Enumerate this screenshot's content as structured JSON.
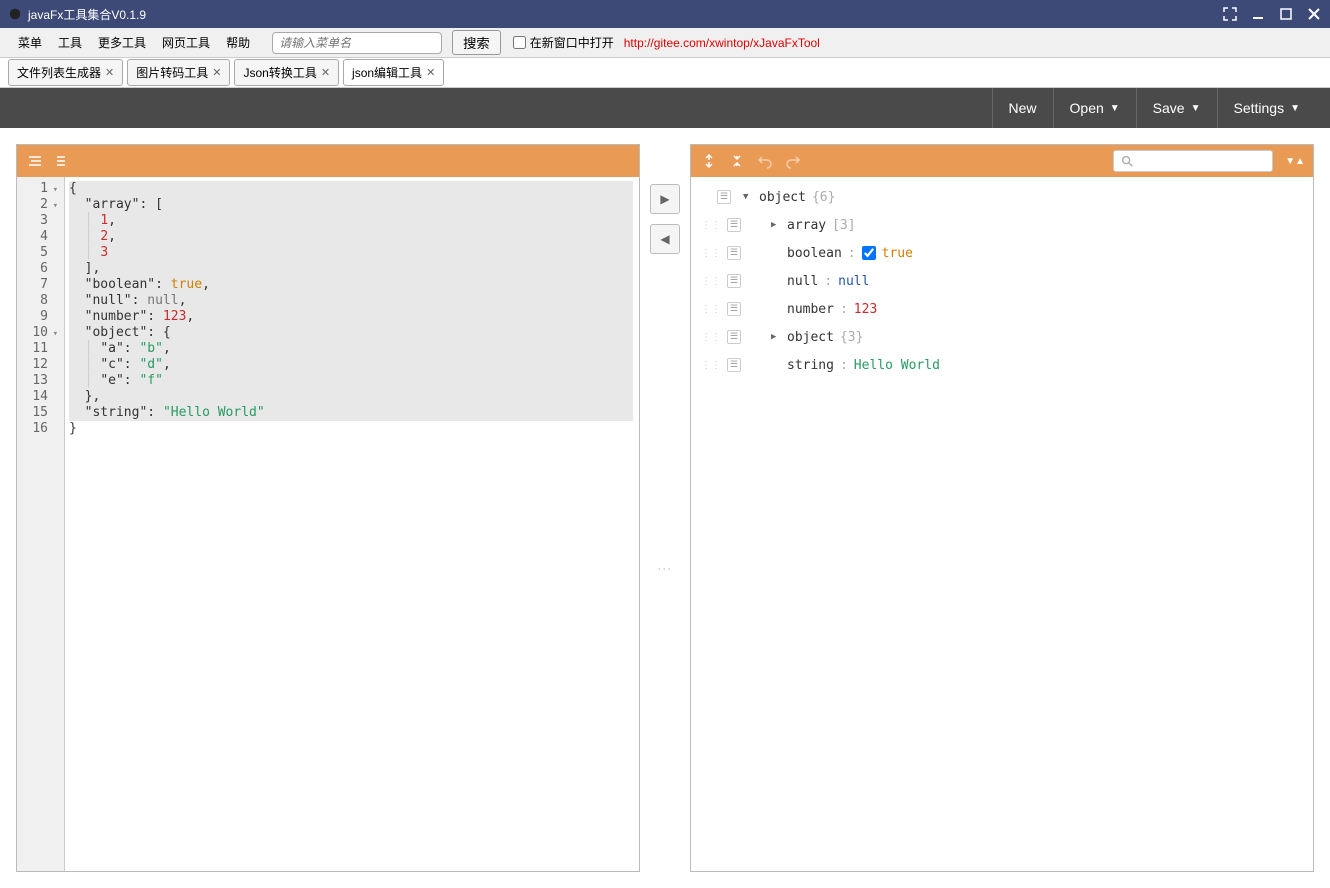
{
  "window": {
    "title": "javaFx工具集合V0.1.9"
  },
  "menu": {
    "items": [
      "菜单",
      "工具",
      "更多工具",
      "网页工具",
      "帮助"
    ],
    "search_placeholder": "请输入菜单名",
    "search_btn": "搜索",
    "checkbox_label": "在新窗口中打开",
    "link_url": "http://gitee.com/xwintop/xJavaFxTool"
  },
  "tabs": {
    "items": [
      "文件列表生成器",
      "图片转码工具",
      "Json转换工具",
      "json编辑工具"
    ],
    "active_index": 3
  },
  "darkbar": {
    "new": "New",
    "open": "Open",
    "save": "Save",
    "settings": "Settings"
  },
  "editor": {
    "lines": [
      {
        "n": 1,
        "fold": true,
        "hl": true,
        "tokens": [
          {
            "t": "{",
            "c": "punc"
          }
        ]
      },
      {
        "n": 2,
        "fold": true,
        "hl": true,
        "tokens": [
          {
            "t": "  ",
            "c": ""
          },
          {
            "t": "\"array\"",
            "c": "key"
          },
          {
            "t": ": [",
            "c": "punc"
          }
        ]
      },
      {
        "n": 3,
        "hl": true,
        "tokens": [
          {
            "t": "  ",
            "c": ""
          },
          {
            "t": "│ ",
            "c": "guide"
          },
          {
            "t": "1",
            "c": "num"
          },
          {
            "t": ",",
            "c": "punc"
          }
        ]
      },
      {
        "n": 4,
        "hl": true,
        "tokens": [
          {
            "t": "  ",
            "c": ""
          },
          {
            "t": "│ ",
            "c": "guide"
          },
          {
            "t": "2",
            "c": "num"
          },
          {
            "t": ",",
            "c": "punc"
          }
        ]
      },
      {
        "n": 5,
        "hl": true,
        "tokens": [
          {
            "t": "  ",
            "c": ""
          },
          {
            "t": "│ ",
            "c": "guide"
          },
          {
            "t": "3",
            "c": "num"
          }
        ]
      },
      {
        "n": 6,
        "hl": true,
        "tokens": [
          {
            "t": "  ],",
            "c": "punc"
          }
        ]
      },
      {
        "n": 7,
        "hl": true,
        "tokens": [
          {
            "t": "  ",
            "c": ""
          },
          {
            "t": "\"boolean\"",
            "c": "key"
          },
          {
            "t": ": ",
            "c": "punc"
          },
          {
            "t": "true",
            "c": "bool"
          },
          {
            "t": ",",
            "c": "punc"
          }
        ]
      },
      {
        "n": 8,
        "hl": true,
        "tokens": [
          {
            "t": "  ",
            "c": ""
          },
          {
            "t": "\"null\"",
            "c": "key"
          },
          {
            "t": ": ",
            "c": "punc"
          },
          {
            "t": "null",
            "c": "null"
          },
          {
            "t": ",",
            "c": "punc"
          }
        ]
      },
      {
        "n": 9,
        "hl": true,
        "tokens": [
          {
            "t": "  ",
            "c": ""
          },
          {
            "t": "\"number\"",
            "c": "key"
          },
          {
            "t": ": ",
            "c": "punc"
          },
          {
            "t": "123",
            "c": "num"
          },
          {
            "t": ",",
            "c": "punc"
          }
        ]
      },
      {
        "n": 10,
        "fold": true,
        "hl": true,
        "tokens": [
          {
            "t": "  ",
            "c": ""
          },
          {
            "t": "\"object\"",
            "c": "key"
          },
          {
            "t": ": {",
            "c": "punc"
          }
        ]
      },
      {
        "n": 11,
        "hl": true,
        "tokens": [
          {
            "t": "  ",
            "c": ""
          },
          {
            "t": "│ ",
            "c": "guide"
          },
          {
            "t": "\"a\"",
            "c": "key"
          },
          {
            "t": ": ",
            "c": "punc"
          },
          {
            "t": "\"b\"",
            "c": "str"
          },
          {
            "t": ",",
            "c": "punc"
          }
        ]
      },
      {
        "n": 12,
        "hl": true,
        "tokens": [
          {
            "t": "  ",
            "c": ""
          },
          {
            "t": "│ ",
            "c": "guide"
          },
          {
            "t": "\"c\"",
            "c": "key"
          },
          {
            "t": ": ",
            "c": "punc"
          },
          {
            "t": "\"d\"",
            "c": "str"
          },
          {
            "t": ",",
            "c": "punc"
          }
        ]
      },
      {
        "n": 13,
        "hl": true,
        "tokens": [
          {
            "t": "  ",
            "c": ""
          },
          {
            "t": "│ ",
            "c": "guide"
          },
          {
            "t": "\"e\"",
            "c": "key"
          },
          {
            "t": ": ",
            "c": "punc"
          },
          {
            "t": "\"f\"",
            "c": "str"
          }
        ]
      },
      {
        "n": 14,
        "hl": true,
        "tokens": [
          {
            "t": "  },",
            "c": "punc"
          }
        ]
      },
      {
        "n": 15,
        "hl": true,
        "tokens": [
          {
            "t": "  ",
            "c": ""
          },
          {
            "t": "\"string\"",
            "c": "key"
          },
          {
            "t": ": ",
            "c": "punc"
          },
          {
            "t": "\"Hello World\"",
            "c": "str"
          }
        ]
      },
      {
        "n": 16,
        "tokens": [
          {
            "t": "}",
            "c": "punc"
          }
        ]
      }
    ]
  },
  "tree": {
    "rows": [
      {
        "indent": 0,
        "expand": "▼",
        "key": "object",
        "meta": "{6}",
        "root": true
      },
      {
        "indent": 1,
        "expand": "▶",
        "key": "array",
        "meta": "[3]"
      },
      {
        "indent": 1,
        "key": "boolean",
        "sep": ":",
        "check": true,
        "val": "true",
        "vc": "bool"
      },
      {
        "indent": 1,
        "key": "null",
        "sep": ":",
        "val": "null",
        "vc": "null"
      },
      {
        "indent": 1,
        "key": "number",
        "sep": ":",
        "val": "123",
        "vc": "num"
      },
      {
        "indent": 1,
        "expand": "▶",
        "key": "object",
        "meta": "{3}"
      },
      {
        "indent": 1,
        "key": "string",
        "sep": ":",
        "val": "Hello World",
        "vc": "str"
      }
    ]
  }
}
